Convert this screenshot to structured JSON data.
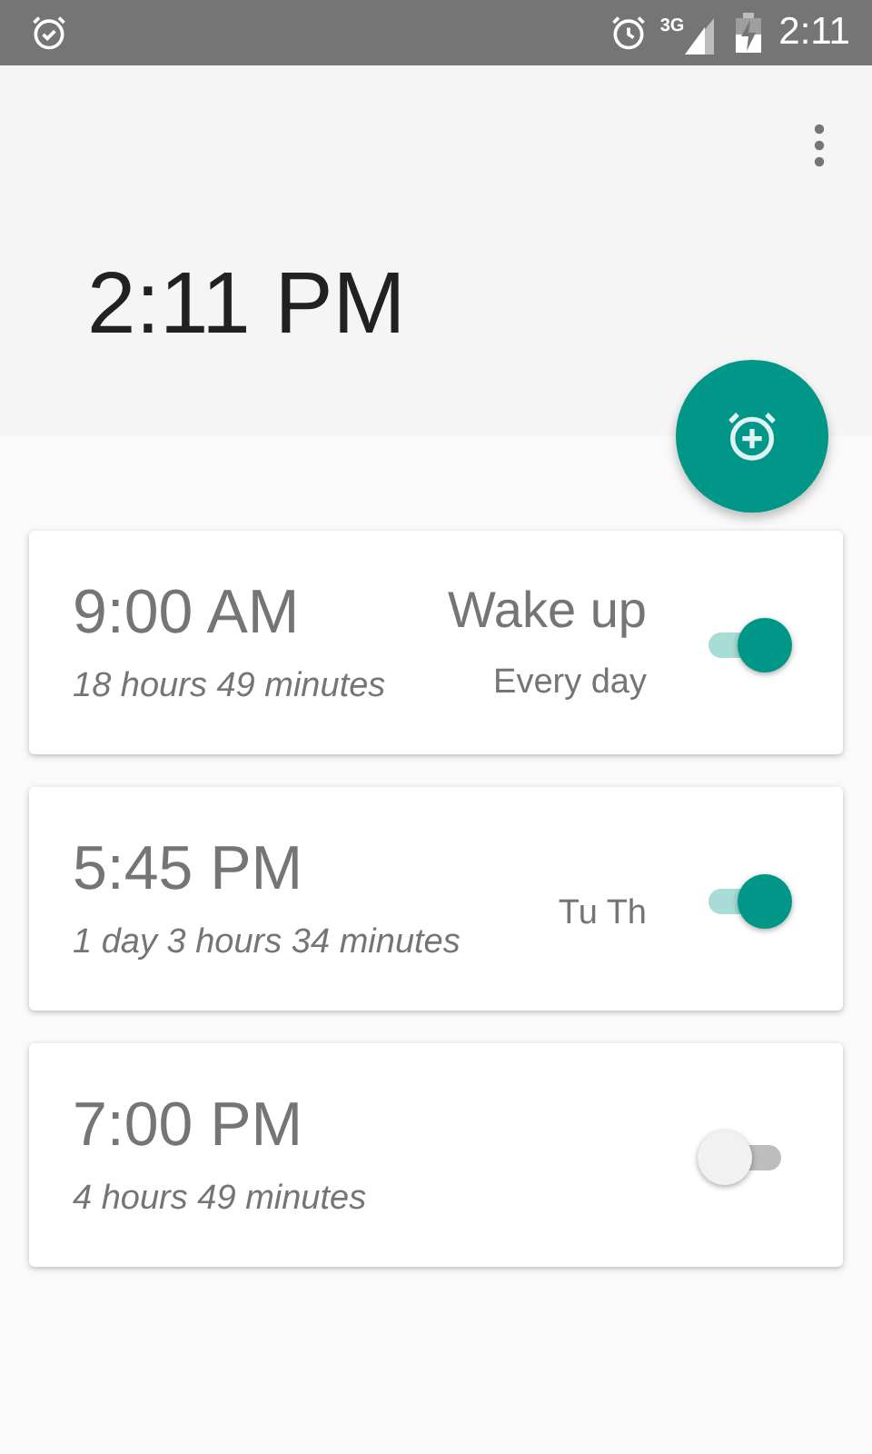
{
  "status_bar": {
    "network": "3G",
    "time": "2:11"
  },
  "header": {
    "clock": "2:11 PM"
  },
  "alarms": [
    {
      "time": "9:00 AM",
      "remaining": "18 hours 49 minutes",
      "label": "Wake up",
      "repeat": "Every day",
      "on": true
    },
    {
      "time": "5:45 PM",
      "remaining": "1 day 3 hours 34 minutes",
      "repeat": "Tu Th",
      "on": true
    },
    {
      "time": "7:00 PM",
      "remaining": "4 hours 49 minutes",
      "on": false
    }
  ]
}
